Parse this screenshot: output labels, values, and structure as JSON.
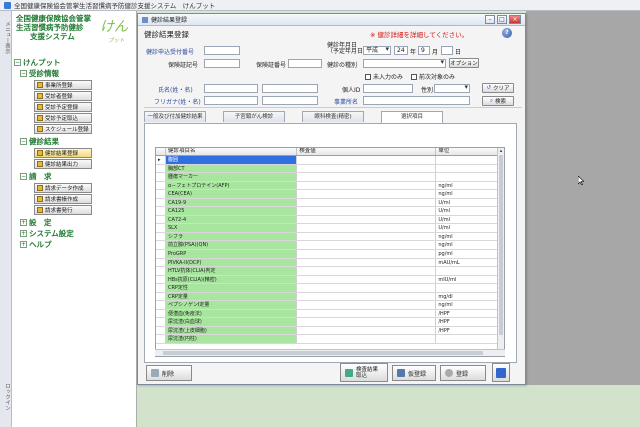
{
  "app_title": "全国健康保険協会管掌生活習慣病予防健診支援システム　けんプット",
  "left_strip": {
    "top_tab": "メニュー表示",
    "bottom_tab": "ロックイン"
  },
  "logo": {
    "line1": "全国健康保険協会管掌",
    "line2": "生活習慣病予防健診",
    "line3": "支援システム",
    "big": "けん",
    "small": "プット"
  },
  "tree": {
    "root": "けんプット",
    "groups": [
      {
        "label": "受診情報",
        "items": [
          "事業所登録",
          "受診者登録",
          "受診予定登録",
          "受診予定取込",
          "スケジュール登録"
        ]
      },
      {
        "label": "健診結果",
        "items": [
          "健診結果登録",
          "健診結果出力"
        ]
      },
      {
        "label": "請　求",
        "items": [
          "請求データ作成",
          "請求書帳作成",
          "請求書発行"
        ]
      }
    ],
    "tail": [
      "設　定",
      "システム設定",
      "ヘルプ"
    ]
  },
  "dialog": {
    "window_title": "健診結果登録",
    "form_title": "健診結果登録",
    "warning": "※ 健診詳細を詳細してください。",
    "help_glyph": "?",
    "fields": {
      "uketsuke_label": "健診申込受付番号",
      "uketsuke_value": "",
      "kenshin_date_label": "健診年月日\n（予定年月日）",
      "era": "平成",
      "year": "24",
      "year_unit": "年",
      "month": "9",
      "month_unit": "月",
      "day": "",
      "day_unit": "日",
      "hihoken_kigou_label": "保険証記号",
      "hihoken_kigou_value": "",
      "hihoken_bangou_label": "保険証番号",
      "hihoken_bangou_value": "",
      "kenshin_shubetsu_label": "健診の種別",
      "kenshin_shubetsu_value": "",
      "option_button": "オプション",
      "check_unentered": "未入力のみ",
      "check_target": "前次対象のみ",
      "name_kanji_label": "氏名(姓・名)",
      "name_kana_label": "フリガナ(姓・名)",
      "kojin_id_label": "個人ID",
      "jigyosho_label": "事業所名",
      "seibetsu_label": "性別",
      "seibetsu_value": "",
      "clear_button": "クリア",
      "search_button": "検索"
    },
    "tabs": [
      "一般及び付加健診結果",
      "子宮頸がん検診",
      "眼科検査(精密)",
      "選択項目"
    ],
    "selected_tab": 3,
    "grid": {
      "headers": [
        "",
        "健診項目名",
        "検査値",
        "単位"
      ],
      "rows": [
        {
          "item": "腹囲",
          "value": "",
          "unit": ""
        },
        {
          "item": "胸部CT",
          "value": "",
          "unit": ""
        },
        {
          "item": "腫瘍マーカー",
          "value": "",
          "unit": ""
        },
        {
          "item": "α－フェトプロテイン(AFP)",
          "value": "",
          "unit": "ng/ml"
        },
        {
          "item": "CEA(CEA)",
          "value": "",
          "unit": "ng/ml"
        },
        {
          "item": "CA19-9",
          "value": "",
          "unit": "U/ml"
        },
        {
          "item": "CA125",
          "value": "",
          "unit": "U/ml"
        },
        {
          "item": "CA72-4",
          "value": "",
          "unit": "U/ml"
        },
        {
          "item": "SLX",
          "value": "",
          "unit": "U/ml"
        },
        {
          "item": "シフラ",
          "value": "",
          "unit": "ng/ml"
        },
        {
          "item": "前立腺(PSA)(QN)",
          "value": "",
          "unit": "ng/ml"
        },
        {
          "item": "ProGRP",
          "value": "",
          "unit": "pg/ml"
        },
        {
          "item": "PIVKA-II(DCP)",
          "value": "",
          "unit": "mAU/mL"
        },
        {
          "item": "HTLV抗体(CLIA)判定",
          "value": "",
          "unit": ""
        },
        {
          "item": "HBs抗原(CLIA)(精密)",
          "value": "",
          "unit": "mIU/ml"
        },
        {
          "item": "CRP定性",
          "value": "",
          "unit": ""
        },
        {
          "item": "CRP定量",
          "value": "",
          "unit": "mg/dl"
        },
        {
          "item": "ペプシノゲンI定量",
          "value": "",
          "unit": "ng/ml"
        },
        {
          "item": "便潜血(免疫法)",
          "value": "",
          "unit": "/HPF"
        },
        {
          "item": "尿沈渣(白血球)",
          "value": "",
          "unit": "/HPF"
        },
        {
          "item": "尿沈渣(上皮細胞)",
          "value": "",
          "unit": "/HPF"
        },
        {
          "item": "尿沈渣(円柱)",
          "value": "",
          "unit": ""
        }
      ]
    },
    "footer": {
      "delete": "削除",
      "import": "検査結果取込",
      "save_temp": "仮登録",
      "register": "登録"
    }
  },
  "colors": {
    "accent": "#2f6fe0",
    "green_cell": "#a8e6a0",
    "warning": "#d01010",
    "brand_green": "#1f7a32"
  }
}
